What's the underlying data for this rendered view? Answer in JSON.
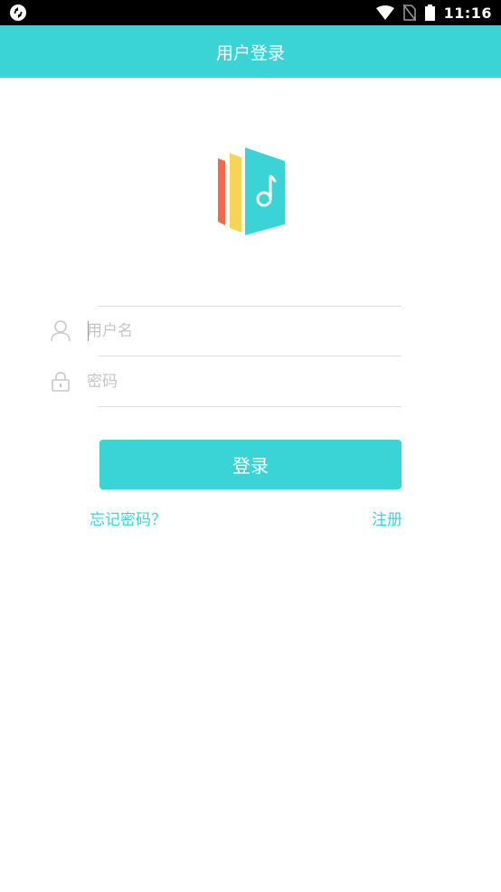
{
  "status_bar": {
    "time": "11:16",
    "icons": [
      "app-sync-icon",
      "wifi-icon",
      "no-sim-icon",
      "battery-icon"
    ]
  },
  "app_bar": {
    "title": "用户登录"
  },
  "logo": {
    "icon": "music-book-logo",
    "colors": [
      "#f2694b",
      "#f7d455",
      "#3ad4d6"
    ]
  },
  "form": {
    "username": {
      "value": "",
      "placeholder": "用户名",
      "icon": "user-icon"
    },
    "password": {
      "value": "",
      "placeholder": "密码",
      "icon": "lock-icon"
    }
  },
  "login_button_label": "登录",
  "links": {
    "forgot_password": "忘记密码？",
    "register": "注册"
  },
  "colors": {
    "accent": "#3ad4d6",
    "status_bar": "#000000",
    "divider": "#dcdcdc",
    "placeholder": "#c4c4c4"
  }
}
